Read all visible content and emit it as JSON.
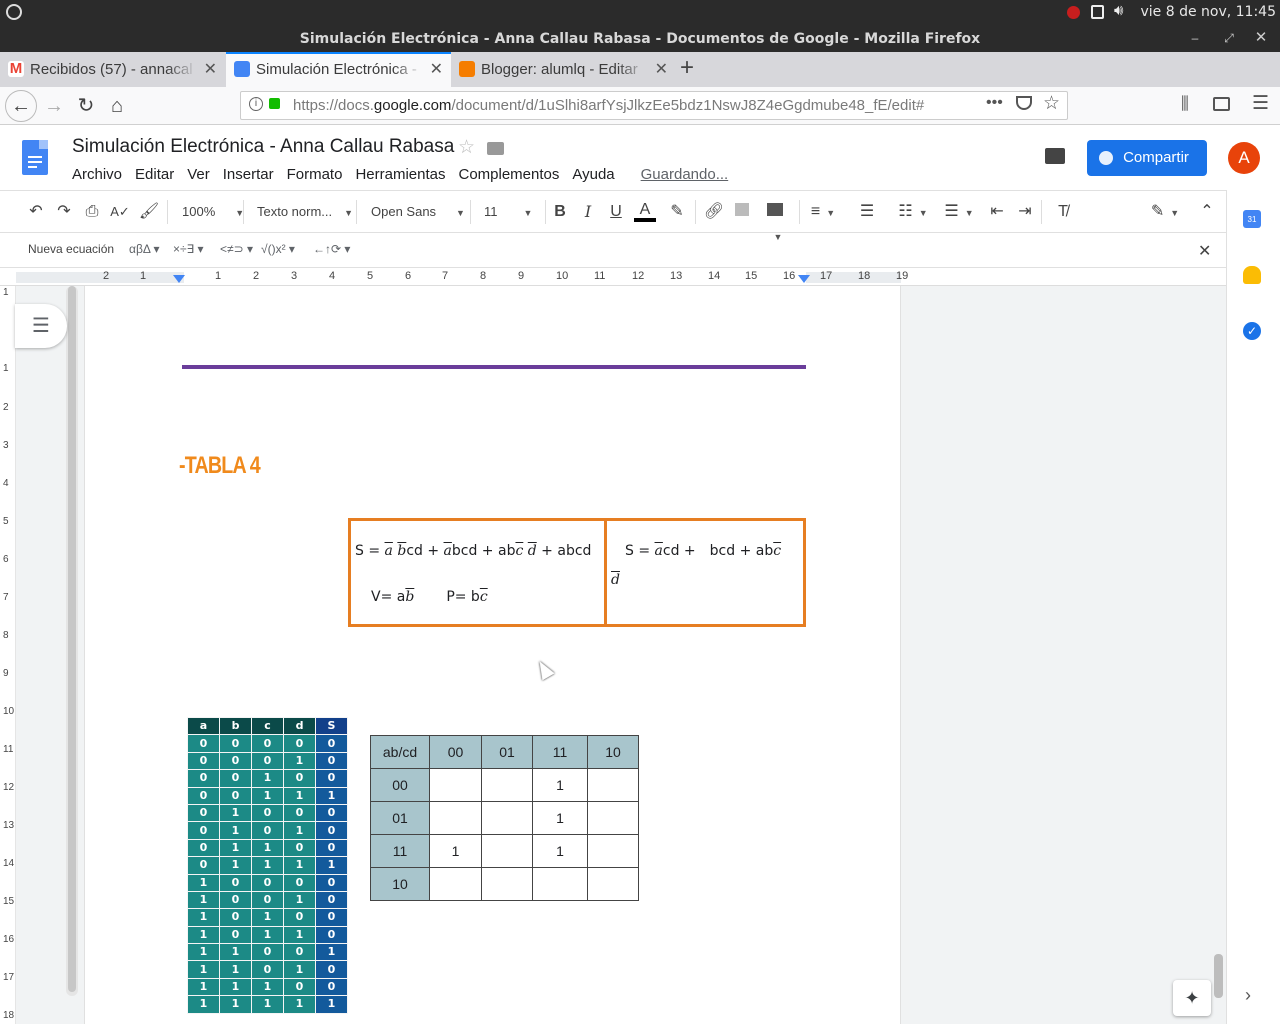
{
  "os": {
    "clock": "vie  8 de nov, 11:45"
  },
  "window": {
    "title": "Simulación Electrónica - Anna Callau Rabasa - Documentos de Google - Mozilla Firefox"
  },
  "tabs": [
    {
      "label": "Recibidos (57) - annacal",
      "color": "#ea4335"
    },
    {
      "label": "Simulación Electrónica -",
      "color": "#4285f4"
    },
    {
      "label": "Blogger: alumlq - Editar",
      "color": "#f57d00"
    }
  ],
  "browser": {
    "url_prefix": "https://docs.",
    "url_domain": "google.com",
    "url_rest": "/document/d/1uSlhi8arfYsjJlkzEe5bdz1NswJ8Z4eGgdmube48_fE/edit#"
  },
  "docs": {
    "title": "Simulación Electrónica - Anna Callau Rabasa",
    "menu": [
      "Archivo",
      "Editar",
      "Ver",
      "Insertar",
      "Formato",
      "Herramientas",
      "Complementos",
      "Ayuda"
    ],
    "saving": "Guardando...",
    "share": "Compartir",
    "avatar": "A",
    "accent": "#1a73e8"
  },
  "toolbar": {
    "zoom": "100%",
    "style": "Texto norm...",
    "font": "Open Sans",
    "size": "11"
  },
  "equation_bar": {
    "new_equation": "Nueva ecuación",
    "groups": [
      "αβΔ",
      "×÷∃",
      "<≠⊃",
      "√()x²",
      "←↑⟳"
    ]
  },
  "ruler": {
    "numbers": [
      "2",
      "1",
      "1",
      "2",
      "3",
      "4",
      "5",
      "6",
      "7",
      "8",
      "9",
      "10",
      "11",
      "12",
      "13",
      "14",
      "15",
      "16",
      "17",
      "18",
      "19"
    ],
    "vertical": [
      "1",
      "1",
      "2",
      "3",
      "4",
      "5",
      "6",
      "7",
      "8",
      "9",
      "10",
      "11",
      "12",
      "13",
      "14",
      "15",
      "16",
      "17",
      "18"
    ]
  },
  "document": {
    "heading": "-TABLA 4",
    "heading_color": "#f08a1c",
    "rule_color": "#6a3d9a",
    "eq_left_line1": [
      "S = ",
      "a",
      "b",
      "cd + ",
      "a",
      "bcd + ab",
      "c",
      "d",
      " + abcd"
    ],
    "eq_left_line2": [
      "V= a",
      "b",
      "P= b",
      "c"
    ],
    "eq_right_line1": [
      "S = ",
      "a",
      "cd +",
      "bcd + ab",
      "c"
    ],
    "eq_right_line2": [
      "d"
    ]
  },
  "truth_table": {
    "headers": [
      "a",
      "b",
      "c",
      "d",
      "S"
    ],
    "rows": [
      [
        "0",
        "0",
        "0",
        "0",
        "0"
      ],
      [
        "0",
        "0",
        "0",
        "1",
        "0"
      ],
      [
        "0",
        "0",
        "1",
        "0",
        "0"
      ],
      [
        "0",
        "0",
        "1",
        "1",
        "1"
      ],
      [
        "0",
        "1",
        "0",
        "0",
        "0"
      ],
      [
        "0",
        "1",
        "0",
        "1",
        "0"
      ],
      [
        "0",
        "1",
        "1",
        "0",
        "0"
      ],
      [
        "0",
        "1",
        "1",
        "1",
        "1"
      ],
      [
        "1",
        "0",
        "0",
        "0",
        "0"
      ],
      [
        "1",
        "0",
        "0",
        "1",
        "0"
      ],
      [
        "1",
        "0",
        "1",
        "0",
        "0"
      ],
      [
        "1",
        "0",
        "1",
        "1",
        "0"
      ],
      [
        "1",
        "1",
        "0",
        "0",
        "1"
      ],
      [
        "1",
        "1",
        "0",
        "1",
        "0"
      ],
      [
        "1",
        "1",
        "1",
        "0",
        "0"
      ],
      [
        "1",
        "1",
        "1",
        "1",
        "1"
      ]
    ]
  },
  "kmap": {
    "corner": "ab/cd",
    "cols": [
      "00",
      "01",
      "11",
      "10"
    ],
    "rows": [
      {
        "label": "00",
        "cells": [
          "",
          "",
          "1",
          ""
        ]
      },
      {
        "label": "01",
        "cells": [
          "",
          "",
          "1",
          ""
        ]
      },
      {
        "label": "11",
        "cells": [
          "1",
          "",
          "1",
          ""
        ]
      },
      {
        "label": "10",
        "cells": [
          "",
          "",
          "",
          ""
        ]
      }
    ]
  }
}
